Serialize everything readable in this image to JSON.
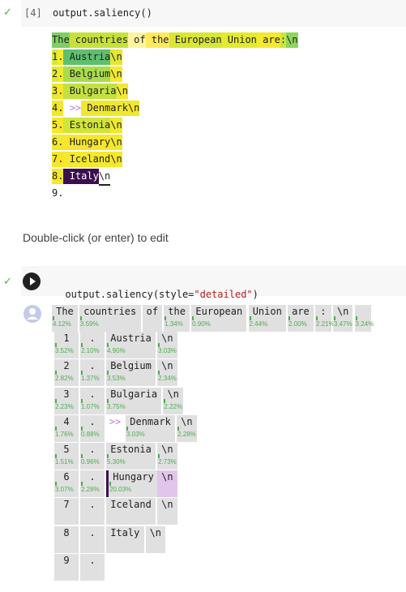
{
  "cell1": {
    "exec_count": "[4]",
    "code": "output.saliency()",
    "status": "✓"
  },
  "saliency_simple": {
    "lines": [
      {
        "tokens": [
          {
            "text": "The",
            "color": "#7fcf63"
          },
          {
            "text": " countries",
            "color": "#c6e23a"
          },
          {
            "text": " of",
            "color": "#fff4a0"
          },
          {
            "text": " the",
            "color": "#ffe95c"
          },
          {
            "text": " European",
            "color": "#d9e634"
          },
          {
            "text": " Union",
            "color": "#e5ea2f"
          },
          {
            "text": " are",
            "color": "#f4e92e"
          },
          {
            "text": ":",
            "color": "#cde53a"
          },
          {
            "text": "\\n",
            "color": "#8ed65a"
          }
        ]
      },
      {
        "tokens": [
          {
            "text": "1",
            "color": "#d7e83a"
          },
          {
            "text": ".",
            "color": "#f3ec2d"
          },
          {
            "text": " Austria",
            "color": "#5fbf6e"
          },
          {
            "text": "\\n",
            "color": "#e4e832"
          }
        ]
      },
      {
        "tokens": [
          {
            "text": "2",
            "color": "#e1e734"
          },
          {
            "text": ".",
            "color": "#f0ea2e"
          },
          {
            "text": " Belgium",
            "color": "#a9dc4a"
          },
          {
            "text": "\\n",
            "color": "#f5e92c"
          }
        ]
      },
      {
        "tokens": [
          {
            "text": "3",
            "color": "#e7e833"
          },
          {
            "text": ".",
            "color": "#f6e82b"
          },
          {
            "text": " Bulgaria",
            "color": "#c2e13f"
          },
          {
            "text": "\\n",
            "color": "#f3e82c"
          }
        ]
      },
      {
        "tokens": [
          {
            "text": "4",
            "color": "#f2e82d"
          },
          {
            "text": ".",
            "color": "#f8e52a"
          },
          {
            "text": " >>",
            "color": "#ffffff",
            "fg": "#c678dd"
          },
          {
            "text": " Denmark",
            "color": "#f0e82e"
          },
          {
            "text": "\\n",
            "color": "#f2e82d"
          }
        ]
      },
      {
        "tokens": [
          {
            "text": "5",
            "color": "#f4e92c"
          },
          {
            "text": ".",
            "color": "#f8e62a"
          },
          {
            "text": " Estonia",
            "color": "#d1e539"
          },
          {
            "text": "\\n",
            "color": "#efe92f"
          }
        ]
      },
      {
        "tokens": [
          {
            "text": "6",
            "color": "#f0e92e"
          },
          {
            "text": ".",
            "color": "#f4e82c"
          },
          {
            "text": " Hungary",
            "color": "#f7e62b"
          },
          {
            "text": "\\n",
            "color": "#f4e82c"
          }
        ]
      },
      {
        "tokens": [
          {
            "text": "7",
            "color": "#f6e72b"
          },
          {
            "text": ".",
            "color": "#f8e52a"
          },
          {
            "text": " Iceland",
            "color": "#f4e92c"
          },
          {
            "text": "\\n",
            "color": "#f6e72b"
          }
        ]
      },
      {
        "tokens": [
          {
            "text": "8",
            "color": "#f7e62b"
          },
          {
            "text": ".",
            "color": "#f5e72c"
          },
          {
            "text": " Italy",
            "color": "#3b0f4f",
            "fg": "#ffffff"
          },
          {
            "text": "\\n",
            "color": "#ffffff",
            "underline": true
          }
        ]
      },
      {
        "tokens": [
          {
            "text": "9.",
            "color": "#ffffff"
          }
        ]
      }
    ]
  },
  "markdown_cell": {
    "text": "Double-click (or enter) to edit"
  },
  "cell2": {
    "status": "✓",
    "code_prefix": "output.saliency(style=",
    "code_string": "\"detailed\"",
    "code_suffix": ")"
  },
  "saliency_detailed": {
    "rows": [
      [
        {
          "text": "The",
          "pct": "4.12%"
        },
        {
          "text": "countries",
          "pct": "3.59%"
        },
        {
          "text": "of",
          "pct": ""
        },
        {
          "text": "the",
          "pct": "1.34%"
        },
        {
          "text": "European",
          "pct": "0.90%"
        },
        {
          "text": "Union",
          "pct": "2.44%"
        },
        {
          "text": "are",
          "pct": "2.00%"
        },
        {
          "text": ":",
          "pct": "2.21%"
        },
        {
          "text": "\\n",
          "pct": "3.47%"
        },
        {
          "text": "",
          "pct": "3.24%"
        }
      ],
      [
        {
          "text": "1",
          "pct": "3.52%"
        },
        {
          "text": ".",
          "pct": "2.10%"
        },
        {
          "text": "Austria",
          "pct": "4.90%"
        },
        {
          "text": "\\n",
          "pct": "3.03%"
        }
      ],
      [
        {
          "text": "2",
          "pct": "2.82%"
        },
        {
          "text": ".",
          "pct": "1.37%"
        },
        {
          "text": "Belgium",
          "pct": "3.53%"
        },
        {
          "text": "\\n",
          "pct": "2.34%"
        }
      ],
      [
        {
          "text": "3",
          "pct": "2.23%"
        },
        {
          "text": ".",
          "pct": "1.07%"
        },
        {
          "text": "Bulgaria",
          "pct": "3.75%"
        },
        {
          "text": "\\n",
          "pct": "2.22%"
        }
      ],
      [
        {
          "text": "4",
          "pct": "1.76%"
        },
        {
          "text": ".",
          "pct": "0.88%"
        },
        {
          "text": ">>",
          "pct": ""
        },
        {
          "text": "Denmark",
          "pct": "3.03%"
        },
        {
          "text": "\\n",
          "pct": "2.28%"
        }
      ],
      [
        {
          "text": "5",
          "pct": "1.51%"
        },
        {
          "text": ".",
          "pct": "0.96%"
        },
        {
          "text": "Estonia",
          "pct": "5.30%"
        },
        {
          "text": "\\n",
          "pct": "2.73%"
        }
      ],
      [
        {
          "text": "6",
          "pct": "3.07%"
        },
        {
          "text": ".",
          "pct": "2.28%"
        },
        {
          "text": "Hungary",
          "pct": "20.03%"
        },
        {
          "text": "\\n",
          "pct": ""
        }
      ],
      [
        {
          "text": "7",
          "pct": ""
        },
        {
          "text": ".",
          "pct": ""
        },
        {
          "text": "Iceland",
          "pct": ""
        },
        {
          "text": "\\n",
          "pct": ""
        }
      ],
      [
        {
          "text": "8",
          "pct": ""
        },
        {
          "text": ".",
          "pct": ""
        },
        {
          "text": "Italy",
          "pct": ""
        },
        {
          "text": "\\n",
          "pct": ""
        }
      ],
      [
        {
          "text": "9",
          "pct": ""
        },
        {
          "text": ".",
          "pct": ""
        }
      ]
    ]
  },
  "colors": {
    "cell_bg": "#f7f7f7",
    "check": "#4caf50",
    "token_bg": "#e0e0e0",
    "selected_token": "#3b0f4f",
    "highlight_token": "#e2c6ea",
    "pct_green": "#4caf50"
  },
  "icons": {
    "status": "check-icon",
    "run": "play-icon",
    "output": "avatar-icon"
  }
}
